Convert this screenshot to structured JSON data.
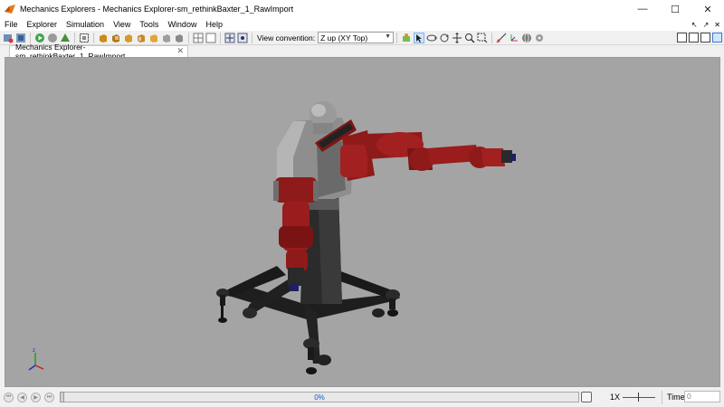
{
  "window": {
    "title": "Mechanics Explorers - Mechanics Explorer-sm_rethinkBaxter_1_RawImport",
    "minimize": "—",
    "maximize": "☐",
    "close": "✕"
  },
  "menu": {
    "items": [
      "File",
      "Explorer",
      "Simulation",
      "View",
      "Tools",
      "Window",
      "Help"
    ],
    "right_icons": [
      "↖",
      "↗",
      "✕"
    ]
  },
  "toolbar": {
    "view_convention_label": "View convention:",
    "view_convention_value": "Z up (XY Top)"
  },
  "tab": {
    "label": "Mechanics Explorer-sm_rethinkBaxter_1_RawImport",
    "close": "✕"
  },
  "scene": {
    "description_icon": "baxter-robot-model",
    "colors": {
      "background": "#a4a4a4",
      "arm_red": "#8f1a1a",
      "body_gray": "#8a8a8a",
      "base_black": "#1e1e1e"
    }
  },
  "playback": {
    "progress_text": "0%",
    "progress_value": 0,
    "speed_label": "1X",
    "time_label": "Time",
    "time_value": "0"
  }
}
